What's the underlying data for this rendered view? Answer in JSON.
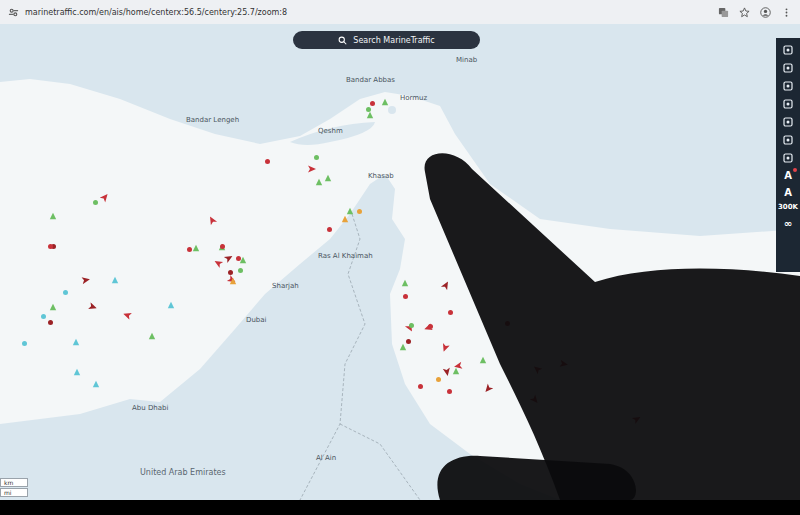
{
  "browser": {
    "url": "marinetraffic.com/en/ais/home/centerx:56.5/centery:25.7/zoom:8"
  },
  "search": {
    "placeholder": "Search MarineTraffic"
  },
  "places": [
    {
      "name": "Bandar Abbas",
      "kind": "city"
    },
    {
      "name": "Hormuz",
      "kind": "city"
    },
    {
      "name": "Qeshm",
      "kind": "city"
    },
    {
      "name": "Bandar Lengeh",
      "kind": "city"
    },
    {
      "name": "Minab",
      "kind": "city"
    },
    {
      "name": "Khasab",
      "kind": "city"
    },
    {
      "name": "Ras Al Khaimah",
      "kind": "city"
    },
    {
      "name": "Sharjah",
      "kind": "city"
    },
    {
      "name": "Dubai",
      "kind": "city"
    },
    {
      "name": "Abu Dhabi",
      "kind": "city"
    },
    {
      "name": "Al Ain",
      "kind": "city"
    },
    {
      "name": "United Arab Emirates",
      "kind": "country"
    }
  ],
  "toolbar": [
    {
      "text": "A",
      "badge": true
    },
    {
      "text": "A",
      "badge": false
    },
    {
      "text": "300K",
      "badge": false
    },
    {
      "text": "∞",
      "badge": false
    }
  ],
  "scale": [
    "km",
    "mi"
  ],
  "vessels": [
    {
      "kind": "dot",
      "color": "#c8323a",
      "heading": 0
    },
    {
      "kind": "arrow",
      "color": "#c8323a",
      "heading": 120
    },
    {
      "kind": "triangle",
      "color": "#6dbf63",
      "heading": 0
    },
    {
      "kind": "dot",
      "color": "#9b2226",
      "heading": 0
    },
    {
      "kind": "arrow",
      "color": "#c8323a",
      "heading": 300
    },
    {
      "kind": "triangle",
      "color": "#6dbf63",
      "heading": 0
    },
    {
      "kind": "dot",
      "color": "#c8323a",
      "heading": 0
    },
    {
      "kind": "triangle",
      "color": "#e8a23a",
      "heading": 0
    },
    {
      "kind": "dot",
      "color": "#6dbf63",
      "heading": 0
    },
    {
      "kind": "arrow",
      "color": "#9b2226",
      "heading": 60
    },
    {
      "kind": "dot",
      "color": "#c8323a",
      "heading": 0
    },
    {
      "kind": "triangle",
      "color": "#6dbf63",
      "heading": 0
    },
    {
      "kind": "dot",
      "color": "#c8323a",
      "heading": 0
    },
    {
      "kind": "dot",
      "color": "#c8323a",
      "heading": 0
    },
    {
      "kind": "arrow",
      "color": "#c8323a",
      "heading": 200
    },
    {
      "kind": "dot",
      "color": "#9b2226",
      "heading": 0
    },
    {
      "kind": "triangle",
      "color": "#6dbf63",
      "heading": 0
    },
    {
      "kind": "dot",
      "color": "#c8323a",
      "heading": 0
    },
    {
      "kind": "arrow",
      "color": "#c8323a",
      "heading": 150
    },
    {
      "kind": "dot",
      "color": "#e8a23a",
      "heading": 0
    },
    {
      "kind": "triangle",
      "color": "#6dbf63",
      "heading": 0
    },
    {
      "kind": "dot",
      "color": "#c8323a",
      "heading": 0
    },
    {
      "kind": "arrow",
      "color": "#9b2226",
      "heading": 30
    },
    {
      "kind": "dot",
      "color": "#6dbf63",
      "heading": 0
    },
    {
      "kind": "arrow",
      "color": "#c8323a",
      "heading": 250
    },
    {
      "kind": "dot",
      "color": "#c8323a",
      "heading": 0
    },
    {
      "kind": "arrow",
      "color": "#c8323a",
      "heading": 290
    },
    {
      "kind": "triangle",
      "color": "#6dbf63",
      "heading": 0
    },
    {
      "kind": "dot",
      "color": "#9b2226",
      "heading": 0
    },
    {
      "kind": "arrow",
      "color": "#9b2226",
      "heading": 110
    },
    {
      "kind": "triangle",
      "color": "#6dbf63",
      "heading": 0
    },
    {
      "kind": "dot",
      "color": "#c8323a",
      "heading": 0
    },
    {
      "kind": "arrow",
      "color": "#c8323a",
      "heading": 40
    },
    {
      "kind": "triangle",
      "color": "#5fc6d6",
      "heading": 0
    },
    {
      "kind": "dot",
      "color": "#9b2226",
      "heading": 0
    },
    {
      "kind": "arrow",
      "color": "#c8323a",
      "heading": 330
    },
    {
      "kind": "triangle",
      "color": "#6dbf63",
      "heading": 0
    },
    {
      "kind": "dot",
      "color": "#6dbf63",
      "heading": 0
    },
    {
      "kind": "triangle",
      "color": "#5fc6d6",
      "heading": 0
    },
    {
      "kind": "dot",
      "color": "#5fc6d6",
      "heading": 0
    },
    {
      "kind": "triangle",
      "color": "#5fc6d6",
      "heading": 0
    },
    {
      "kind": "dot",
      "color": "#5fc6d6",
      "heading": 0
    },
    {
      "kind": "triangle",
      "color": "#5fc6d6",
      "heading": 0
    },
    {
      "kind": "dot",
      "color": "#5fc6d6",
      "heading": 0
    },
    {
      "kind": "triangle",
      "color": "#5fc6d6",
      "heading": 0
    },
    {
      "kind": "arrow",
      "color": "#9b2226",
      "heading": 80
    },
    {
      "kind": "arrow",
      "color": "#c8323a",
      "heading": 140
    },
    {
      "kind": "arrow",
      "color": "#9b2226",
      "heading": 220
    },
    {
      "kind": "arrow",
      "color": "#c8323a",
      "heading": 100
    },
    {
      "kind": "triangle",
      "color": "#6dbf63",
      "heading": 0
    },
    {
      "kind": "arrow",
      "color": "#c8323a",
      "heading": 310
    },
    {
      "kind": "arrow",
      "color": "#9b2226",
      "heading": 170
    },
    {
      "kind": "dot",
      "color": "#c8323a",
      "heading": 0
    },
    {
      "kind": "arrow",
      "color": "#c8323a",
      "heading": 60
    },
    {
      "kind": "triangle",
      "color": "#6dbf63",
      "heading": 0
    },
    {
      "kind": "arrow",
      "color": "#c8323a",
      "heading": 260
    },
    {
      "kind": "triangle",
      "color": "#6dbf63",
      "heading": 0
    },
    {
      "kind": "dot",
      "color": "#6dbf63",
      "heading": 0
    },
    {
      "kind": "triangle",
      "color": "#6dbf63",
      "heading": 0
    },
    {
      "kind": "dot",
      "color": "#c8323a",
      "heading": 0
    },
    {
      "kind": "triangle",
      "color": "#6dbf63",
      "heading": 0
    },
    {
      "kind": "dot",
      "color": "#c8323a",
      "heading": 0
    },
    {
      "kind": "triangle",
      "color": "#6dbf63",
      "heading": 0
    },
    {
      "kind": "arrow",
      "color": "#c8323a",
      "heading": 90
    },
    {
      "kind": "dot",
      "color": "#6dbf63",
      "heading": 0
    },
    {
      "kind": "dot",
      "color": "#e8a23a",
      "heading": 0
    },
    {
      "kind": "triangle",
      "color": "#6dbf63",
      "heading": 0
    },
    {
      "kind": "dot",
      "color": "#c8323a",
      "heading": 0
    },
    {
      "kind": "triangle",
      "color": "#e8a23a",
      "heading": 0
    }
  ]
}
